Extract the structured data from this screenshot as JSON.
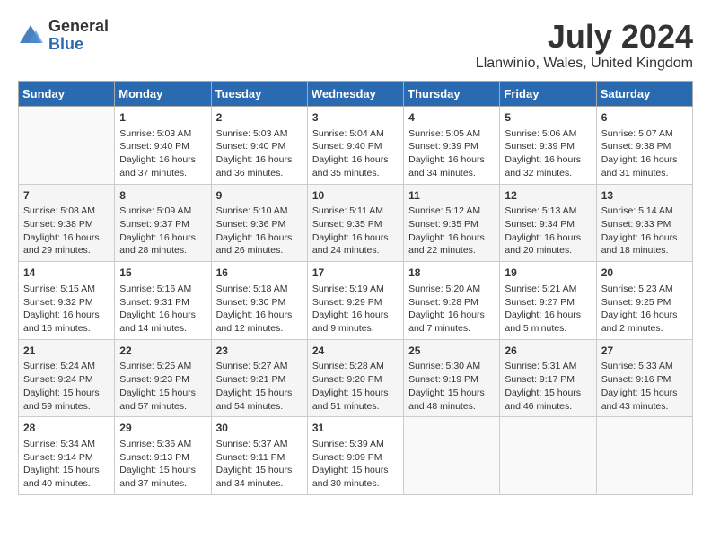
{
  "header": {
    "logo_general": "General",
    "logo_blue": "Blue",
    "title": "July 2024",
    "subtitle": "Llanwinio, Wales, United Kingdom"
  },
  "days_of_week": [
    "Sunday",
    "Monday",
    "Tuesday",
    "Wednesday",
    "Thursday",
    "Friday",
    "Saturday"
  ],
  "weeks": [
    [
      {
        "day": "",
        "info": ""
      },
      {
        "day": "1",
        "info": "Sunrise: 5:03 AM\nSunset: 9:40 PM\nDaylight: 16 hours\nand 37 minutes."
      },
      {
        "day": "2",
        "info": "Sunrise: 5:03 AM\nSunset: 9:40 PM\nDaylight: 16 hours\nand 36 minutes."
      },
      {
        "day": "3",
        "info": "Sunrise: 5:04 AM\nSunset: 9:40 PM\nDaylight: 16 hours\nand 35 minutes."
      },
      {
        "day": "4",
        "info": "Sunrise: 5:05 AM\nSunset: 9:39 PM\nDaylight: 16 hours\nand 34 minutes."
      },
      {
        "day": "5",
        "info": "Sunrise: 5:06 AM\nSunset: 9:39 PM\nDaylight: 16 hours\nand 32 minutes."
      },
      {
        "day": "6",
        "info": "Sunrise: 5:07 AM\nSunset: 9:38 PM\nDaylight: 16 hours\nand 31 minutes."
      }
    ],
    [
      {
        "day": "7",
        "info": "Sunrise: 5:08 AM\nSunset: 9:38 PM\nDaylight: 16 hours\nand 29 minutes."
      },
      {
        "day": "8",
        "info": "Sunrise: 5:09 AM\nSunset: 9:37 PM\nDaylight: 16 hours\nand 28 minutes."
      },
      {
        "day": "9",
        "info": "Sunrise: 5:10 AM\nSunset: 9:36 PM\nDaylight: 16 hours\nand 26 minutes."
      },
      {
        "day": "10",
        "info": "Sunrise: 5:11 AM\nSunset: 9:35 PM\nDaylight: 16 hours\nand 24 minutes."
      },
      {
        "day": "11",
        "info": "Sunrise: 5:12 AM\nSunset: 9:35 PM\nDaylight: 16 hours\nand 22 minutes."
      },
      {
        "day": "12",
        "info": "Sunrise: 5:13 AM\nSunset: 9:34 PM\nDaylight: 16 hours\nand 20 minutes."
      },
      {
        "day": "13",
        "info": "Sunrise: 5:14 AM\nSunset: 9:33 PM\nDaylight: 16 hours\nand 18 minutes."
      }
    ],
    [
      {
        "day": "14",
        "info": "Sunrise: 5:15 AM\nSunset: 9:32 PM\nDaylight: 16 hours\nand 16 minutes."
      },
      {
        "day": "15",
        "info": "Sunrise: 5:16 AM\nSunset: 9:31 PM\nDaylight: 16 hours\nand 14 minutes."
      },
      {
        "day": "16",
        "info": "Sunrise: 5:18 AM\nSunset: 9:30 PM\nDaylight: 16 hours\nand 12 minutes."
      },
      {
        "day": "17",
        "info": "Sunrise: 5:19 AM\nSunset: 9:29 PM\nDaylight: 16 hours\nand 9 minutes."
      },
      {
        "day": "18",
        "info": "Sunrise: 5:20 AM\nSunset: 9:28 PM\nDaylight: 16 hours\nand 7 minutes."
      },
      {
        "day": "19",
        "info": "Sunrise: 5:21 AM\nSunset: 9:27 PM\nDaylight: 16 hours\nand 5 minutes."
      },
      {
        "day": "20",
        "info": "Sunrise: 5:23 AM\nSunset: 9:25 PM\nDaylight: 16 hours\nand 2 minutes."
      }
    ],
    [
      {
        "day": "21",
        "info": "Sunrise: 5:24 AM\nSunset: 9:24 PM\nDaylight: 15 hours\nand 59 minutes."
      },
      {
        "day": "22",
        "info": "Sunrise: 5:25 AM\nSunset: 9:23 PM\nDaylight: 15 hours\nand 57 minutes."
      },
      {
        "day": "23",
        "info": "Sunrise: 5:27 AM\nSunset: 9:21 PM\nDaylight: 15 hours\nand 54 minutes."
      },
      {
        "day": "24",
        "info": "Sunrise: 5:28 AM\nSunset: 9:20 PM\nDaylight: 15 hours\nand 51 minutes."
      },
      {
        "day": "25",
        "info": "Sunrise: 5:30 AM\nSunset: 9:19 PM\nDaylight: 15 hours\nand 48 minutes."
      },
      {
        "day": "26",
        "info": "Sunrise: 5:31 AM\nSunset: 9:17 PM\nDaylight: 15 hours\nand 46 minutes."
      },
      {
        "day": "27",
        "info": "Sunrise: 5:33 AM\nSunset: 9:16 PM\nDaylight: 15 hours\nand 43 minutes."
      }
    ],
    [
      {
        "day": "28",
        "info": "Sunrise: 5:34 AM\nSunset: 9:14 PM\nDaylight: 15 hours\nand 40 minutes."
      },
      {
        "day": "29",
        "info": "Sunrise: 5:36 AM\nSunset: 9:13 PM\nDaylight: 15 hours\nand 37 minutes."
      },
      {
        "day": "30",
        "info": "Sunrise: 5:37 AM\nSunset: 9:11 PM\nDaylight: 15 hours\nand 34 minutes."
      },
      {
        "day": "31",
        "info": "Sunrise: 5:39 AM\nSunset: 9:09 PM\nDaylight: 15 hours\nand 30 minutes."
      },
      {
        "day": "",
        "info": ""
      },
      {
        "day": "",
        "info": ""
      },
      {
        "day": "",
        "info": ""
      }
    ]
  ]
}
